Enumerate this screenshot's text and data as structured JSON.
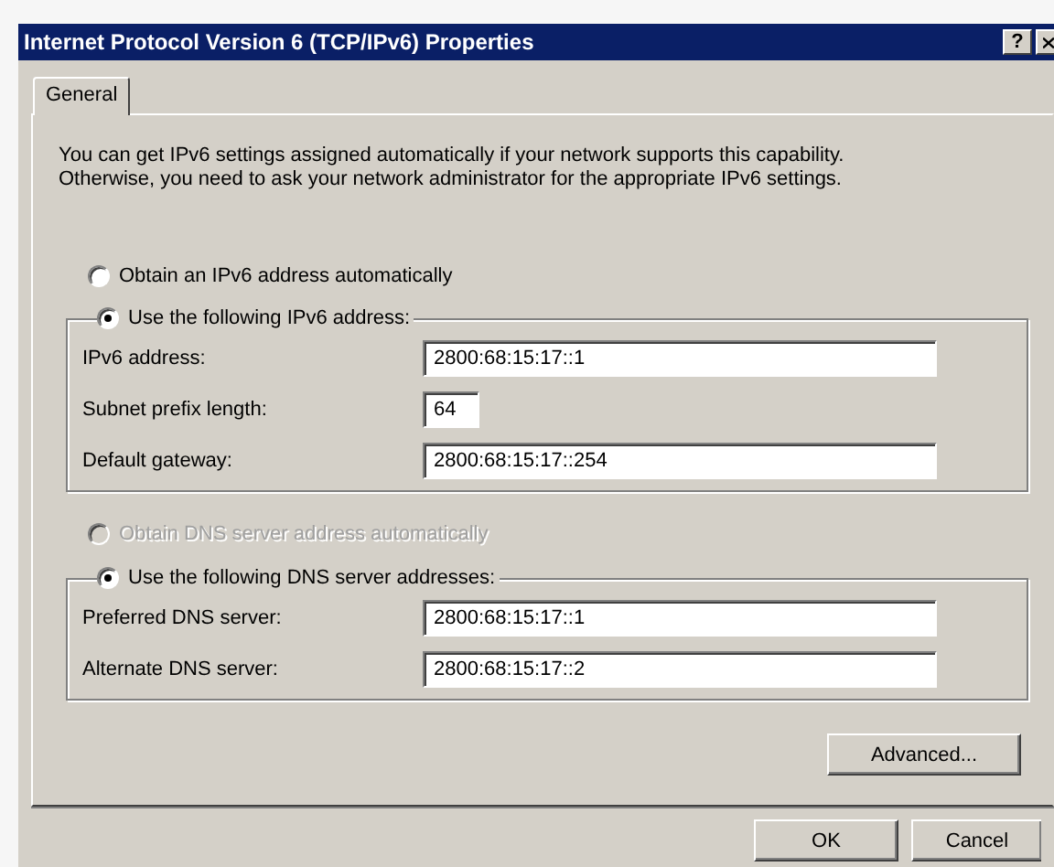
{
  "window": {
    "title": "Internet Protocol Version 6 (TCP/IPv6) Properties",
    "help": "?"
  },
  "tabs": [
    {
      "label": "General",
      "selected": true
    }
  ],
  "intro": "You can get IPv6 settings assigned automatically if your network supports this capability.\nOtherwise, you need to ask your network administrator for the appropriate IPv6 settings.",
  "address": {
    "options": [
      {
        "label": "Obtain an IPv6 address automatically",
        "selected": false,
        "disabled": false
      },
      {
        "label": "Use the following IPv6 address:",
        "selected": true,
        "disabled": false
      }
    ],
    "fields": [
      {
        "label": "IPv6 address:",
        "value": "2800:68:15:17::1",
        "kind": "wide"
      },
      {
        "label": "Subnet prefix length:",
        "value": "64",
        "kind": "short"
      },
      {
        "label": "Default gateway:",
        "value": "2800:68:15:17::254",
        "kind": "wide"
      }
    ]
  },
  "dns": {
    "options": [
      {
        "label": "Obtain DNS server address automatically",
        "selected": false,
        "disabled": true
      },
      {
        "label": "Use the following DNS server addresses:",
        "selected": true,
        "disabled": false
      }
    ],
    "fields": [
      {
        "label": "Preferred DNS server:",
        "value": "2800:68:15:17::1",
        "kind": "wide"
      },
      {
        "label": "Alternate DNS server:",
        "value": "2800:68:15:17::2",
        "kind": "wide"
      }
    ]
  },
  "advanced_button": "Advanced...",
  "ok_button": "OK",
  "cancel_button": "Cancel"
}
